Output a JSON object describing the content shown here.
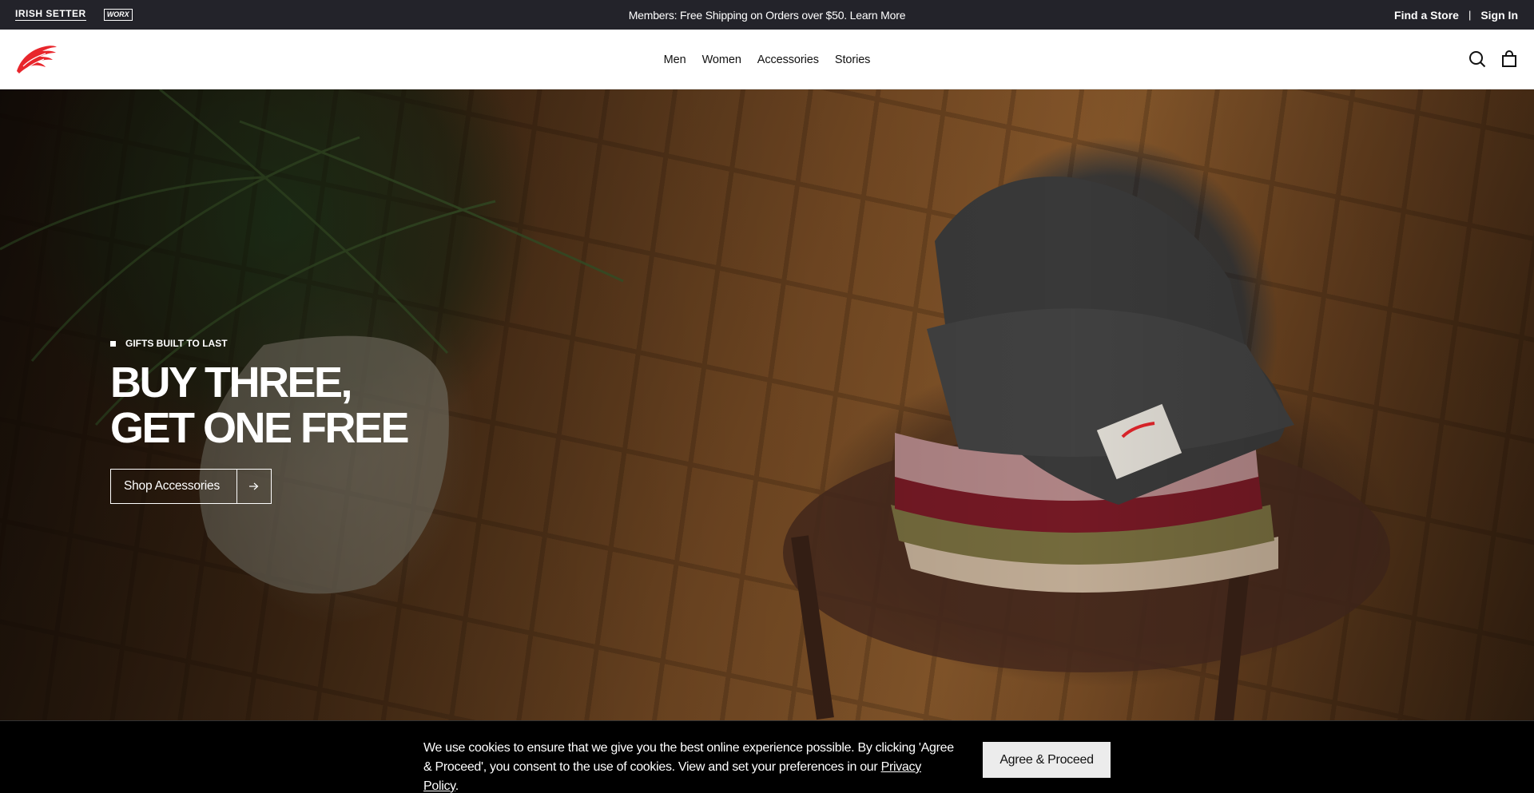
{
  "utility_bar": {
    "sub_brands": [
      "IRISH SETTER",
      "WORX"
    ],
    "promo_text": "Members: Free Shipping on Orders over $50. Learn More",
    "find_store": "Find a Store",
    "separator": "|",
    "sign_in": "Sign In"
  },
  "header": {
    "logo_name": "Red Wing wing logo",
    "nav": [
      "Men",
      "Women",
      "Accessories",
      "Stories"
    ],
    "icons": [
      "search-icon",
      "bag-icon"
    ]
  },
  "hero": {
    "eyebrow": "GIFTS BUILT TO LAST",
    "headline_line1": "BUY THREE,",
    "headline_line2": "GET ONE FREE",
    "cta_label": "Shop Accessories",
    "cta_icon": "arrow-right-icon"
  },
  "cookie": {
    "text_before_link": "We use cookies to ensure that we give you the best online experience possible. By clicking 'Agree & Proceed', you consent to the use of cookies. View and set your preferences in our ",
    "link_text": "Privacy Policy",
    "text_after_link": ".",
    "button_label": "Agree & Proceed"
  },
  "colors": {
    "utility_bg": "#23232a",
    "brand_red": "#e8262c",
    "cookie_bg": "#000000",
    "button_bg": "#ececec"
  }
}
